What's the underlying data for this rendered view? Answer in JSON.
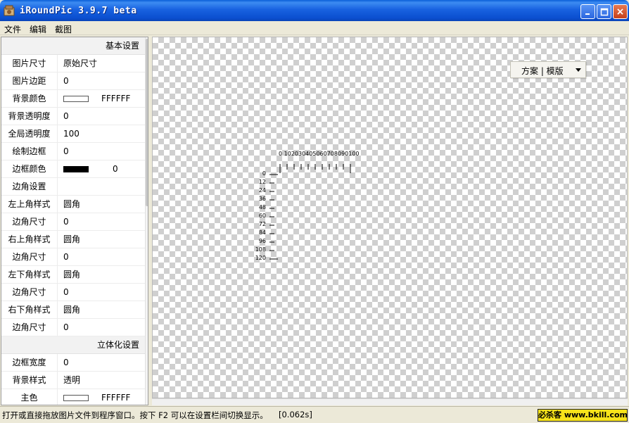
{
  "window": {
    "title": "iRoundPic 3.9.7 beta",
    "close_glyph": "×"
  },
  "menu": [
    "文件",
    "编辑",
    "截图"
  ],
  "panel": {
    "sections": [
      {
        "title": "基本设置",
        "rows": [
          {
            "label": "图片尺寸",
            "value": "原始尺寸"
          },
          {
            "label": "图片边距",
            "value": "0"
          },
          {
            "label": "背景颜色",
            "swatch": "#FFFFFF",
            "value": "FFFFFF"
          },
          {
            "label": "背景透明度",
            "value": "0"
          },
          {
            "label": "全局透明度",
            "value": "100"
          },
          {
            "label": "绘制边框",
            "value": "0"
          },
          {
            "label": "边框颜色",
            "swatch": "#000000",
            "value": "0"
          },
          {
            "label": "边角设置",
            "value": ""
          },
          {
            "label": "左上角样式",
            "value": "圆角"
          },
          {
            "label": "边角尺寸",
            "value": "0"
          },
          {
            "label": "右上角样式",
            "value": "圆角"
          },
          {
            "label": "边角尺寸",
            "value": "0"
          },
          {
            "label": "左下角样式",
            "value": "圆角"
          },
          {
            "label": "边角尺寸",
            "value": "0"
          },
          {
            "label": "右下角样式",
            "value": "圆角"
          },
          {
            "label": "边角尺寸",
            "value": "0"
          }
        ]
      },
      {
        "title": "立体化设置",
        "rows": [
          {
            "label": "边框宽度",
            "value": "0"
          },
          {
            "label": "背景样式",
            "value": "透明"
          },
          {
            "label": "主色",
            "swatch": "#FFFFFF",
            "value": "FFFFFF"
          }
        ]
      }
    ]
  },
  "canvas": {
    "scheme_button": "方案 | 模版",
    "ruler_top": "0 102030405060708090100",
    "ruler_left": [
      "0",
      "12",
      "24",
      "36",
      "48",
      "60",
      "72",
      "84",
      "96",
      "108",
      "120"
    ]
  },
  "status": {
    "hint": "打开或直接拖放图片文件到程序窗口。按下 F2 可以在设置栏间切换显示。",
    "elapsed": "[0.062s]",
    "watermark": "必杀客 www.bkill.com"
  },
  "colors": {
    "titlebar": "#0b4fd0",
    "watermark_bg": "#f7e31a"
  },
  "icons": {
    "app": "app-icon",
    "minimize": "minimize-icon",
    "maximize": "maximize-icon",
    "close": "close-icon",
    "dropdown": "chevron-down-icon"
  }
}
